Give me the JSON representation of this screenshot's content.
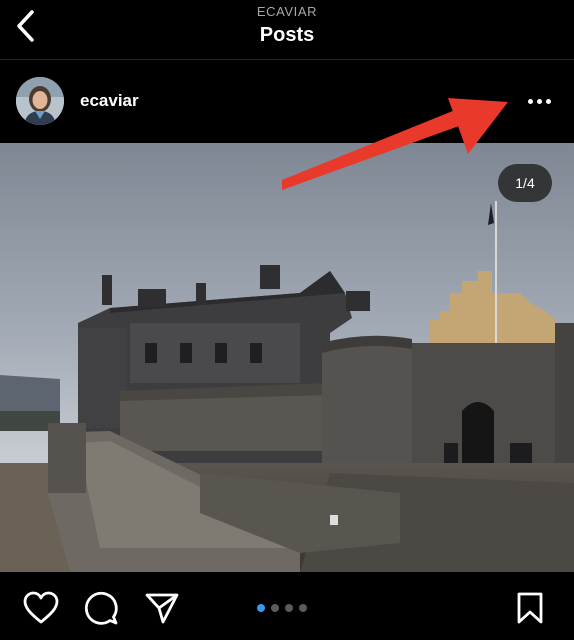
{
  "header": {
    "subtitle": "ECAVIAR",
    "title": "Posts"
  },
  "post": {
    "username": "ecaviar",
    "image_counter": "1/4",
    "carousel": {
      "total": 4,
      "active_index": 0
    }
  },
  "icons": {
    "back": "chevron-left-icon",
    "more": "more-horizontal-icon",
    "like": "heart-icon",
    "comment": "comment-bubble-icon",
    "share": "send-icon",
    "save": "bookmark-icon"
  },
  "colors": {
    "background": "#000000",
    "annotation_arrow": "#e8392b",
    "active_dot": "#3797f0"
  }
}
